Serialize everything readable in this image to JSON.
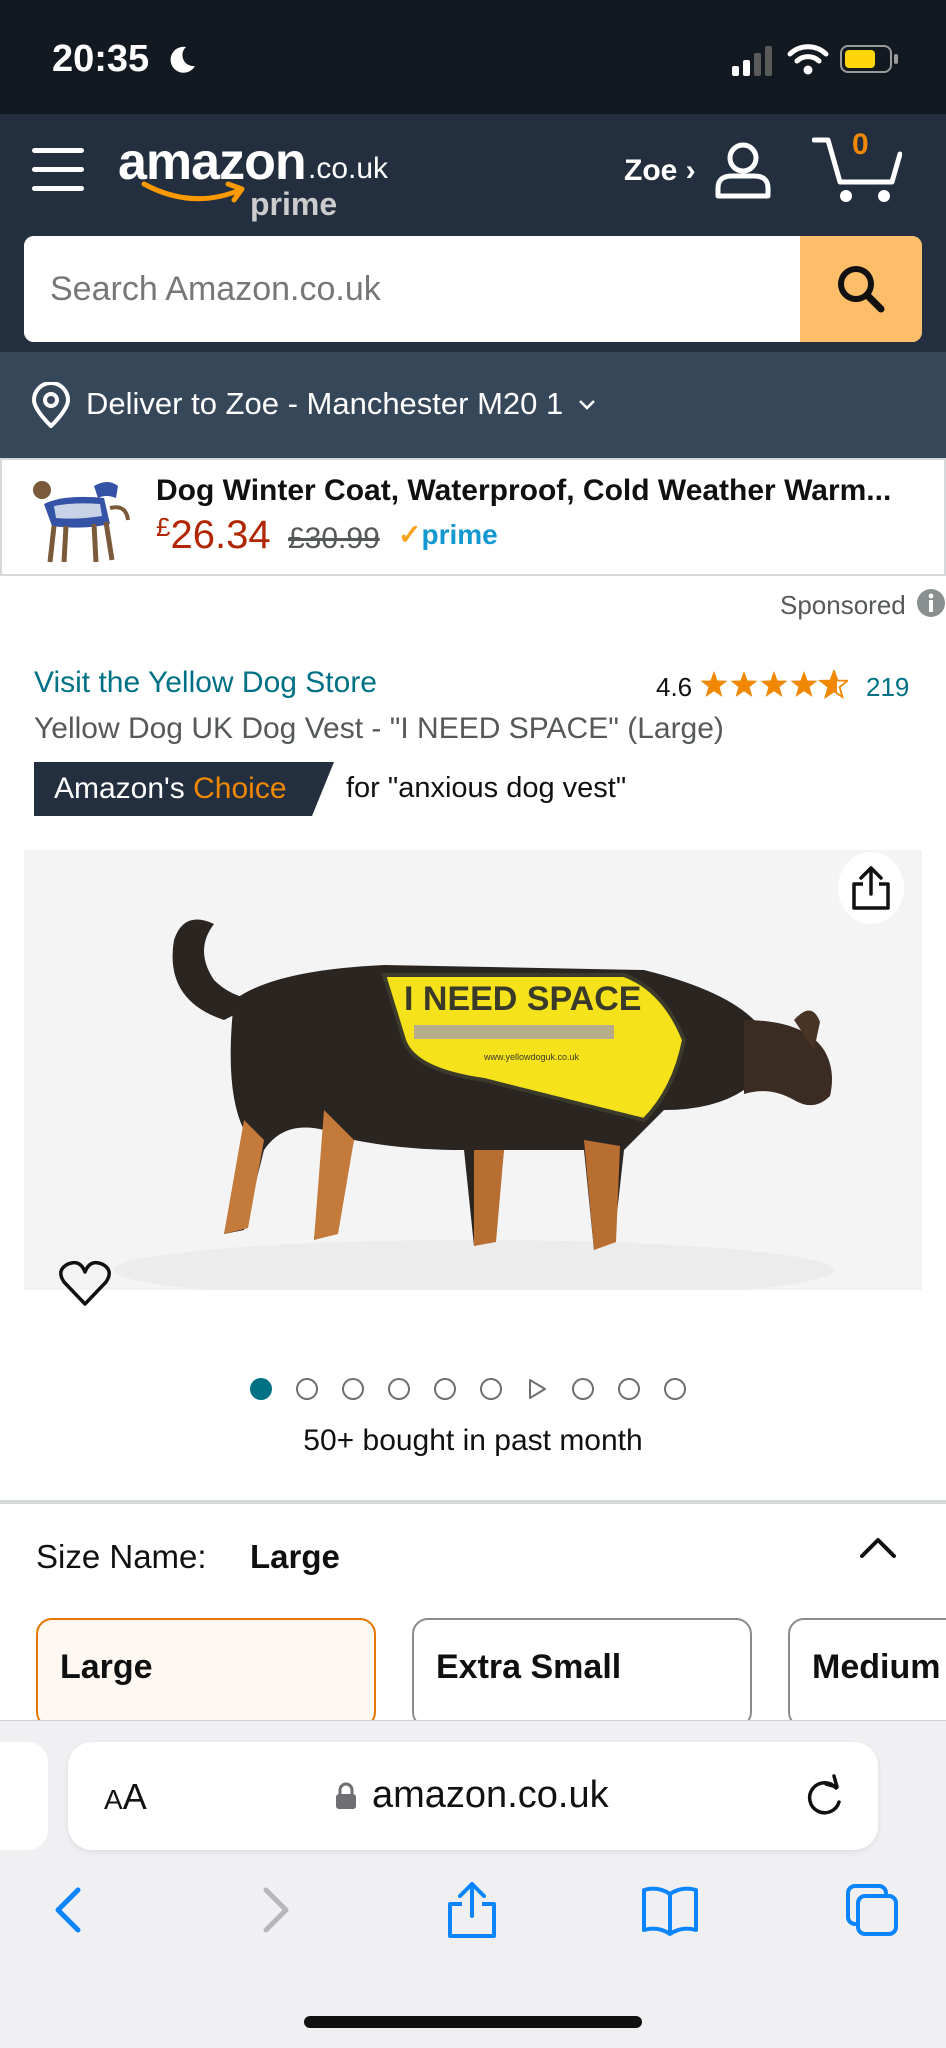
{
  "status_bar": {
    "time": "20:35"
  },
  "header": {
    "logo_word": "amazon",
    "logo_tld": ".co.uk",
    "logo_prime": "prime",
    "account_name": "Zoe ›",
    "cart_count": "0",
    "search_placeholder": "Search Amazon.co.uk"
  },
  "deliver": {
    "text": "Deliver to Zoe - Manchester M20 1"
  },
  "ad": {
    "title": "Dog Winter Coat, Waterproof, Cold Weather Warm...",
    "price_currency": "£",
    "price_value": "26.34",
    "old_price": "£30.99",
    "prime_label": "prime"
  },
  "sponsored_label": "Sponsored",
  "product": {
    "store_link": "Visit the Yellow Dog Store",
    "rating": "4.6",
    "rating_value": 4.6,
    "rating_count": "219",
    "title": "Yellow Dog UK Dog Vest - \"I NEED SPACE\" (Large)",
    "choice_part1": "Amazon's ",
    "choice_part2": "Choice",
    "choice_for": "for \"anxious dog vest\"",
    "vest_text": "I NEED SPACE",
    "vest_url": "www.yellowdoguk.co.uk",
    "bought": "50+ bought in past month"
  },
  "size": {
    "label": "Size Name:",
    "value": "Large",
    "options": [
      "Large",
      "Extra Small",
      "Medium"
    ]
  },
  "browser": {
    "aa_small": "A",
    "aa_big": "A",
    "url": "amazon.co.uk"
  },
  "colors": {
    "header_bg": "#232f3e",
    "deliver_bg": "#37475a",
    "search_button": "#febd69",
    "link": "#007185",
    "price": "#b12704",
    "star": "#f08804"
  }
}
